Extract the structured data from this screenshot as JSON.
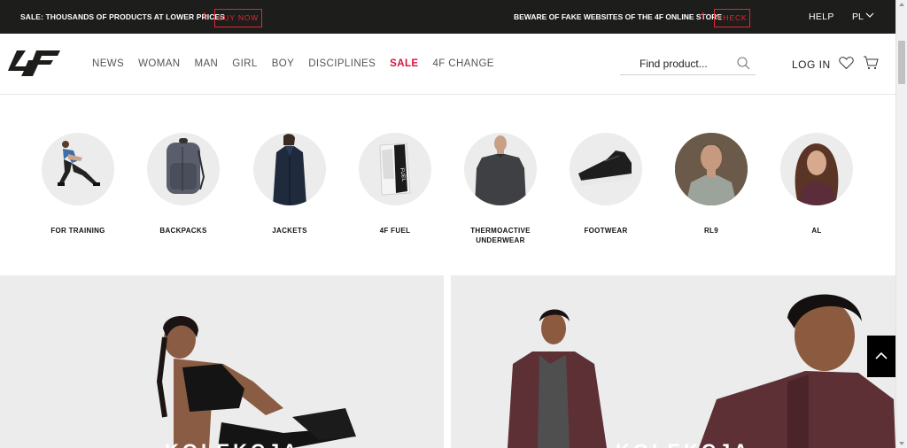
{
  "topbar": {
    "promo_text": "SALE: THOUSANDS OF PRODUCTS AT LOWER PRICES",
    "promo_button": "BUY NOW",
    "warning_text": "BEWARE OF FAKE WEBSITES OF THE 4F ONLINE STORE",
    "warning_button": "CHECK",
    "exclamation": "!",
    "help": "HELP",
    "language": "PL"
  },
  "header": {
    "logo_text": "4F",
    "nav": [
      "NEWS",
      "WOMAN",
      "MAN",
      "GIRL",
      "BOY",
      "DISCIPLINES",
      "SALE",
      "4F CHANGE"
    ],
    "search_placeholder": "Find product...",
    "login": "LOG IN"
  },
  "categories": [
    {
      "label": "FOR TRAINING"
    },
    {
      "label": "BACKPACKS"
    },
    {
      "label": "JACKETS"
    },
    {
      "label": "4F FUEL"
    },
    {
      "label": "THERMOACTIVE UNDERWEAR"
    },
    {
      "label": "FOOTWEAR"
    },
    {
      "label": "RL9"
    },
    {
      "label": "AL"
    }
  ],
  "banners": [
    {
      "caption": "KOLEKCJA"
    },
    {
      "caption": "KOLEKCJA"
    }
  ],
  "colors": {
    "topbar_bg": "#1d1d1b",
    "accent_red": "#e3262f",
    "sale_red": "#d6143c"
  },
  "icons": [
    "search-icon",
    "heart-icon",
    "cart-icon",
    "chevron-down-icon",
    "chevron-up-icon"
  ]
}
